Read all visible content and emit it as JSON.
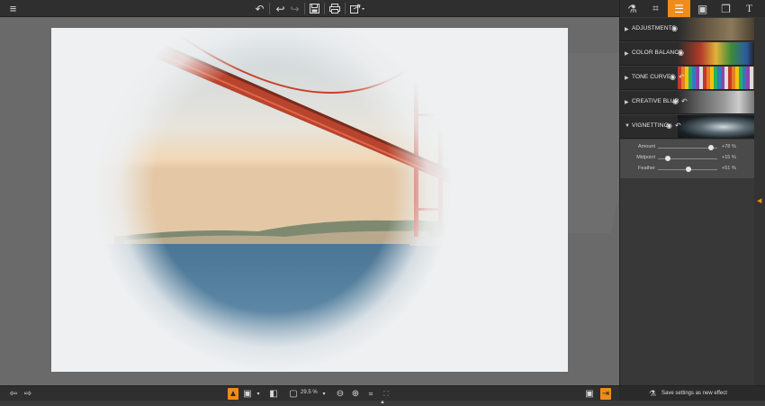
{
  "toolbar": {
    "menu_icon": "hamburger-icon",
    "buttons": [
      "undo-icon",
      "undo-all-icon",
      "redo-icon",
      "save-icon",
      "print-icon",
      "share-icon"
    ]
  },
  "panel_tabs": [
    {
      "name": "flask-icon",
      "glyph": "⚗"
    },
    {
      "name": "crop-icon",
      "glyph": "⌗"
    },
    {
      "name": "adjust-sliders-icon",
      "glyph": "☰"
    },
    {
      "name": "frame-icon",
      "glyph": "▣"
    },
    {
      "name": "layers-icon",
      "glyph": "❐"
    },
    {
      "name": "text-icon",
      "glyph": "T"
    }
  ],
  "effects": [
    {
      "label": "ADJUSTMENTS",
      "eye": "◉",
      "reset": ""
    },
    {
      "label": "COLOR BALANCE",
      "eye": "◉",
      "reset": ""
    },
    {
      "label": "TONE CURVES",
      "eye": "◉",
      "reset": "↶"
    },
    {
      "label": "CREATIVE BLUR",
      "eye": "◉",
      "reset": "↶"
    },
    {
      "label": "VIGNETTING",
      "eye": "◉",
      "reset": "↶"
    }
  ],
  "vignetting_controls": [
    {
      "label": "Amount",
      "value": "+78 %",
      "level": 0.89
    },
    {
      "label": "Midpoint",
      "value": "+15 %",
      "level": 0.16
    },
    {
      "label": "Feather",
      "value": "+51 %",
      "level": 0.51
    }
  ],
  "bottom": {
    "zoom": "29.5 %",
    "save_effect": "Save settings as new effect"
  },
  "colors": {
    "accent": "#f08c1a"
  }
}
